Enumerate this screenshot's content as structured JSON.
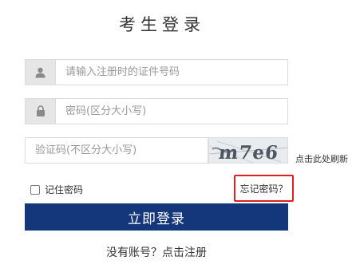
{
  "title": "考生登录",
  "form": {
    "id_placeholder": "请输入注册时的证件号码",
    "password_placeholder": "密码(区分大小写)",
    "captcha_placeholder": "验证码(不区分大小写)",
    "captcha_text": "m7e6",
    "refresh_label": "点击此处刷新",
    "remember_label": "记住密码",
    "forgot_label": "忘记密码？",
    "login_label": "立即登录",
    "register_label": "没有账号？点击注册"
  },
  "icons": {
    "id_field": "user-icon",
    "password_field": "lock-icon"
  },
  "colors": {
    "primary_button": "#14377c",
    "forgot_highlight": "#e02020"
  }
}
